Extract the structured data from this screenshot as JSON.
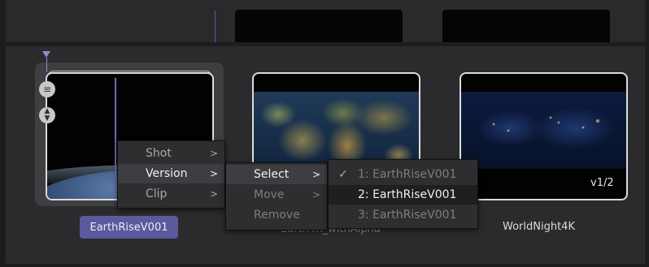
{
  "clips": [
    {
      "name": "EarthRiseV001",
      "selected": true
    },
    {
      "name": "Earth4K_withAlpha",
      "selected": false
    },
    {
      "name": "WorldNight4K",
      "selected": false,
      "badge": "v1/2"
    }
  ],
  "context_menu": {
    "items": [
      {
        "label": "Shot",
        "has_submenu": true
      },
      {
        "label": "Version",
        "has_submenu": true,
        "highlighted": true
      },
      {
        "label": "Clip",
        "has_submenu": true
      }
    ],
    "version_submenu": [
      {
        "label": "Select",
        "has_submenu": true,
        "highlighted": true
      },
      {
        "label": "Move",
        "has_submenu": true,
        "disabled": true
      },
      {
        "label": "Remove",
        "disabled": true
      }
    ],
    "select_submenu": [
      {
        "label": "1: EarthRiseV001",
        "checked": true
      },
      {
        "label": "2: EarthRiseV001",
        "highlighted": true
      },
      {
        "label": "3: EarthRiseV001"
      }
    ],
    "arrow": ">",
    "checkmark": "✓"
  },
  "icons": {
    "playhead": "playhead-marker-icon",
    "stack": "version-stack-icon",
    "updown": "up-down-icon"
  },
  "colors": {
    "accent": "#5b5a9c",
    "playhead": "#8d8bd6"
  }
}
